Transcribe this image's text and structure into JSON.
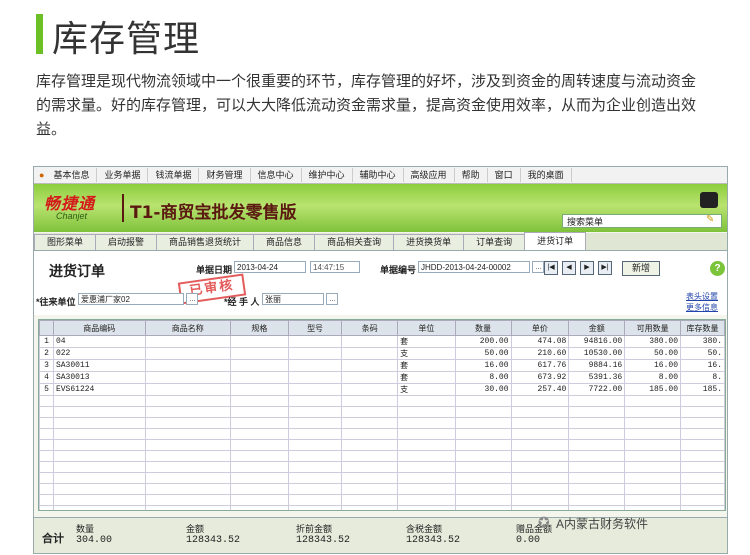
{
  "article": {
    "title": "库存管理",
    "paragraph": "库存管理是现代物流领域中一个很重要的环节，库存管理的好坏，涉及到资金的周转速度与流动资金的需求量。好的库存管理，可以大大降低流动资金需求量，提高资金使用效率，从而为企业创造出效益。"
  },
  "menubar": [
    "基本信息",
    "业务单据",
    "钱流单据",
    "财务管理",
    "信息中心",
    "维护中心",
    "辅助中心",
    "高级应用",
    "帮助",
    "窗口",
    "我的桌面"
  ],
  "banner": {
    "logo_cn": "畅捷通",
    "logo_en": "Chanjet",
    "product": "T1-商贸宝批发零售版",
    "search_placeholder": "搜索菜单"
  },
  "tabs": [
    {
      "label": "图形菜单",
      "active": false
    },
    {
      "label": "启动报警",
      "active": false
    },
    {
      "label": "商品销售退货统计",
      "active": false
    },
    {
      "label": "商品信息",
      "active": false
    },
    {
      "label": "商品相关查询",
      "active": false
    },
    {
      "label": "进货换货单",
      "active": false
    },
    {
      "label": "订单查询",
      "active": false
    },
    {
      "label": "进货订单",
      "active": true
    }
  ],
  "form": {
    "title": "进货订单",
    "date_label": "单据日期",
    "date_value": "2013-04-24",
    "time_value": "14:47:15",
    "number_label": "单据编号",
    "number_value": "JHDD-2013-04-24-00002",
    "new_button": "新增",
    "stamp": "已审核",
    "supplier_label": "*往来单位",
    "supplier_value": "爱惠浦厂家02",
    "handler_label": "*经 手 人",
    "handler_value": "张丽",
    "link_header_settings": "表头设置",
    "link_more_info": "更多信息"
  },
  "grid": {
    "columns": [
      "",
      "商品编码",
      "商品名称",
      "规格",
      "型号",
      "条码",
      "单位",
      "数量",
      "单价",
      "金额",
      "可用数量",
      "库存数量"
    ],
    "rows": [
      [
        "1",
        "04",
        "",
        "",
        "",
        "",
        "套",
        "200.00",
        "474.08",
        "94816.00",
        "380.00",
        "380."
      ],
      [
        "2",
        "022",
        "",
        "",
        "",
        "",
        "支",
        "50.00",
        "210.60",
        "10530.00",
        "50.00",
        "50."
      ],
      [
        "3",
        "SA30011",
        "",
        "",
        "",
        "",
        "套",
        "16.00",
        "617.76",
        "9884.16",
        "16.00",
        "16."
      ],
      [
        "4",
        "SA30013",
        "",
        "",
        "",
        "",
        "套",
        "8.00",
        "673.92",
        "5391.36",
        "8.00",
        "8."
      ],
      [
        "5",
        "EVS61224",
        "",
        "",
        "",
        "",
        "支",
        "30.00",
        "257.40",
        "7722.00",
        "185.00",
        "185."
      ]
    ]
  },
  "summary": {
    "total_label": "合计",
    "qty_label": "数量",
    "qty_value": "304.00",
    "amount_label": "金额",
    "amount_value": "128343.52",
    "discount_label": "折前金额",
    "discount_value": "128343.52",
    "tax_label": "含税金额",
    "tax_value": "128343.52",
    "gift_label": "赠品金额",
    "gift_value": "0.00"
  },
  "watermark": "A内蒙古财务软件"
}
